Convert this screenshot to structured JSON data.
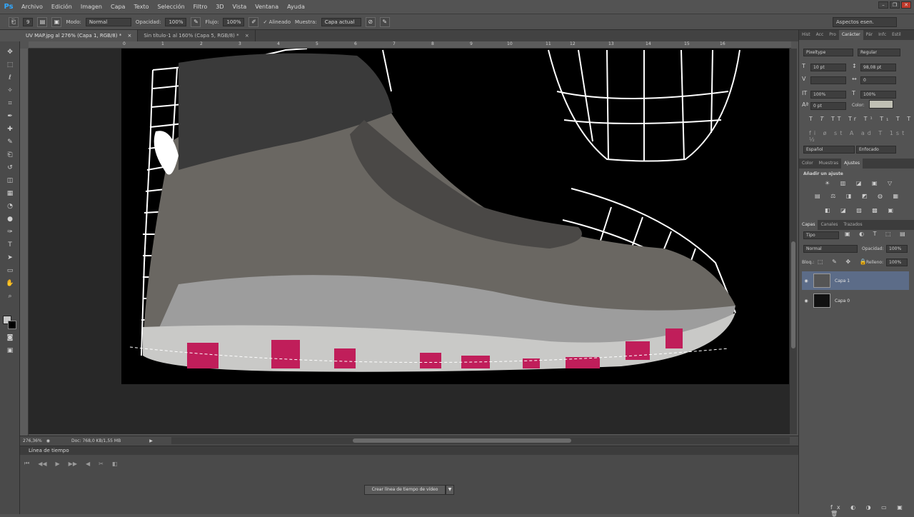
{
  "menubar": {
    "logo": "Ps",
    "items": [
      "Archivo",
      "Edición",
      "Imagen",
      "Capa",
      "Texto",
      "Selección",
      "Filtro",
      "3D",
      "Vista",
      "Ventana",
      "Ayuda"
    ]
  },
  "options": {
    "mode_label": "Modo:",
    "mode_value": "Normal",
    "opacity_label": "Opacidad:",
    "opacity_value": "100%",
    "flow_label": "Flujo:",
    "flow_value": "100%",
    "aligned_label": "Alineado",
    "sample_label": "Muestra:",
    "sample_value": "Capa actual",
    "brush_size": "9",
    "workspace": "Aspectos esen."
  },
  "tabs": [
    {
      "label": "UV MAP.jpg al 276% (Capa 1, RGB/8) *",
      "close": "×"
    },
    {
      "label": "Sin título-1 al 160% (Capa 5, RGB/8) *",
      "close": "×"
    }
  ],
  "ruler_h": [
    "0",
    "1",
    "2",
    "3",
    "4",
    "5",
    "6",
    "7",
    "8",
    "9",
    "10",
    "11",
    "12",
    "13",
    "14",
    "15",
    "16"
  ],
  "status": {
    "zoom": "276,36%",
    "doc": "Doc: 768,0 KB/1,55 MB"
  },
  "timeline": {
    "title": "Línea de tiempo",
    "create_button": "Crear línea de tiempo de vídeo"
  },
  "panels": {
    "top_tabs": [
      "Hist",
      "Acc",
      "Pro",
      "Carácter",
      "Pár",
      "Infc",
      "Estil"
    ],
    "font_family": "Pixeltype",
    "font_style": "Regular",
    "font_size": "10 pt",
    "leading": "98,08 pt",
    "tracking": "0",
    "vscale": "100%",
    "hscale": "100%",
    "baseline": "0 pt",
    "color_label": "Color:",
    "language": "Español",
    "aa_label": "aa",
    "antialias": "Enfocado",
    "adj_tabs": [
      "Color",
      "Muestras",
      "Ajustes"
    ],
    "adj_title": "Añadir un ajuste",
    "layer_tabs": [
      "Capas",
      "Canales",
      "Trazados"
    ],
    "layer_kind": "Tipo",
    "blend_mode": "Normal",
    "opacity_label": "Opacidad:",
    "opacity_value": "100%",
    "lock_label": "Bloq.:",
    "fill_label": "Relleno:",
    "fill_value": "100%",
    "layers": [
      {
        "name": "Capa 1",
        "selected": true
      },
      {
        "name": "Capa 0",
        "selected": false
      }
    ]
  }
}
